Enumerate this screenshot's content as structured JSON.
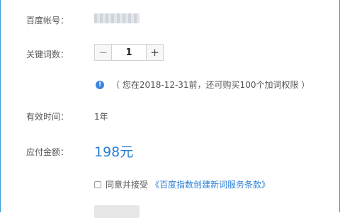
{
  "form": {
    "account": {
      "label": "百度帐号："
    },
    "keywords": {
      "label": "关键词数：",
      "minus": "−",
      "quantity": "1",
      "plus": "+"
    },
    "notice": {
      "icon": "info-icon",
      "icon_glyph": "!",
      "text": "（ 您在2018-12-31前，还可购买100个加词权限 ）"
    },
    "validity": {
      "label": "有效时间：",
      "value": "1年"
    },
    "payment": {
      "label": "应付金额：",
      "amount": "198元"
    },
    "agreement": {
      "text": "同意并接受",
      "link": "《百度指数创建新词服务条款》"
    }
  },
  "colors": {
    "accent": "#2a7ed3",
    "frame_border": "#3a9fd8",
    "info_icon": "#3d84e0",
    "label_text": "#555555"
  }
}
